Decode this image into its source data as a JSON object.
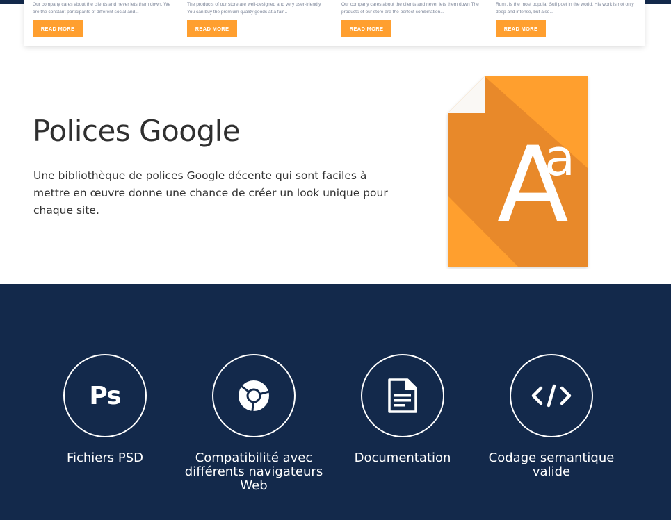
{
  "cards": [
    {
      "excerpt": "Our company cares about the clients and never lets them down. We are the constant participants of different social and...",
      "button_label": "READ MORE"
    },
    {
      "excerpt": "The products of our store are well-designed and very user-friendly You can buy the premium quality goods at a fair...",
      "button_label": "READ MORE"
    },
    {
      "excerpt": "Our company cares about the clients and never lets them down The products of our store are the perfect combination...",
      "button_label": "READ MORE"
    },
    {
      "excerpt": "Rumi, is the most popular Sufi poet in the world. His work is not only deep and intense, but also...",
      "button_label": "READ MORE"
    }
  ],
  "feature": {
    "title": "Polices Google",
    "description": "Une bibliothèque de polices Google décente qui sont faciles à mettre en œuvre donne une chance de créer un look unique pour chaque site.",
    "icon": "font-document-icon",
    "icon_glyph_main": "A",
    "icon_glyph_sup": "a"
  },
  "features_list": [
    {
      "label": "Fichiers PSD",
      "icon": "photoshop-icon",
      "icon_text": "Ps"
    },
    {
      "label": "Compatibilité avec différents navigateurs Web",
      "icon": "chrome-icon"
    },
    {
      "label": "Documentation",
      "icon": "document-icon"
    },
    {
      "label": "Codage semantique valide",
      "icon": "code-icon"
    }
  ],
  "colors": {
    "navy": "#13294b",
    "orange": "#ff9f2f",
    "orange_dark": "#e8892a",
    "white": "#ffffff"
  }
}
